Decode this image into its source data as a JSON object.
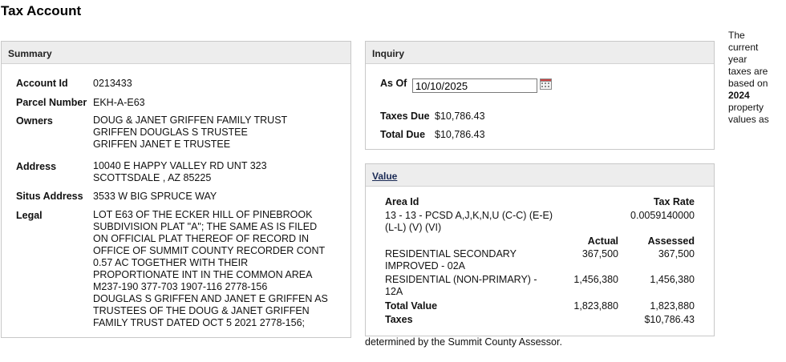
{
  "page": {
    "title": "Tax Account"
  },
  "summary": {
    "header": "Summary",
    "account_id_label": "Account Id",
    "account_id": "0213433",
    "parcel_label": "Parcel Number",
    "parcel": "EKH-A-E63",
    "owners_label": "Owners",
    "owners": [
      "DOUG & JANET GRIFFEN FAMILY TRUST",
      "GRIFFEN DOUGLAS S TRUSTEE",
      "GRIFFEN JANET E TRUSTEE"
    ],
    "address_label": "Address",
    "address": [
      "10040 E HAPPY VALLEY RD UNT 323",
      "SCOTTSDALE , AZ 85225"
    ],
    "situs_label": "Situs Address",
    "situs": "3533 W BIG SPRUCE WAY",
    "legal_label": "Legal",
    "legal": [
      "LOT E63 OF THE ECKER HILL OF PINEBROOK",
      "SUBDIVISION PLAT \"A\"; THE SAME AS IS FILED",
      "ON OFFICIAL PLAT THEREOF OF RECORD IN",
      "OFFICE OF SUMMIT COUNTY RECORDER CONT",
      "0.57 AC TOGETHER WITH THEIR",
      "PROPORTIONATE INT IN THE COMMON AREA",
      "M237-190 377-703 1907-116 2778-156",
      "DOUGLAS S GRIFFEN AND JANET E GRIFFEN AS",
      "TRUSTEES OF THE DOUG & JANET GRIFFEN",
      "FAMILY TRUST DATED OCT 5 2021 2778-156;"
    ]
  },
  "inquiry": {
    "header": "Inquiry",
    "as_of_label": "As Of",
    "as_of_value": "10/10/2025",
    "taxes_due_label": "Taxes Due",
    "taxes_due": "$10,786.43",
    "total_due_label": "Total Due",
    "total_due": "$10,786.43",
    "calendar_icon": "calendar-icon"
  },
  "value": {
    "header": "Value",
    "area_id_label": "Area Id",
    "tax_rate_label": "Tax Rate",
    "area_id": [
      "13 - 13 - PCSD A,J,K,N,U (C-C) (E-E)",
      "(L-L) (V) (VI)"
    ],
    "tax_rate": "0.0059140000",
    "actual_label": "Actual",
    "assessed_label": "Assessed",
    "rows": [
      {
        "name": [
          "RESIDENTIAL SECONDARY",
          "IMPROVED - 02A"
        ],
        "actual": "367,500",
        "assessed": "367,500"
      },
      {
        "name": [
          "RESIDENTIAL (NON-PRIMARY) -",
          "12A"
        ],
        "actual": "1,456,380",
        "assessed": "1,456,380"
      }
    ],
    "total_value_label": "Total Value",
    "total_actual": "1,823,880",
    "total_assessed": "1,823,880",
    "taxes_label": "Taxes",
    "taxes": "$10,786.43"
  },
  "note": {
    "side": [
      "The",
      "current",
      "year",
      "taxes are",
      "based on"
    ],
    "side_year": "2024",
    "side_end": [
      "property",
      "values as"
    ],
    "footer": "determined by the Summit County Assessor."
  }
}
